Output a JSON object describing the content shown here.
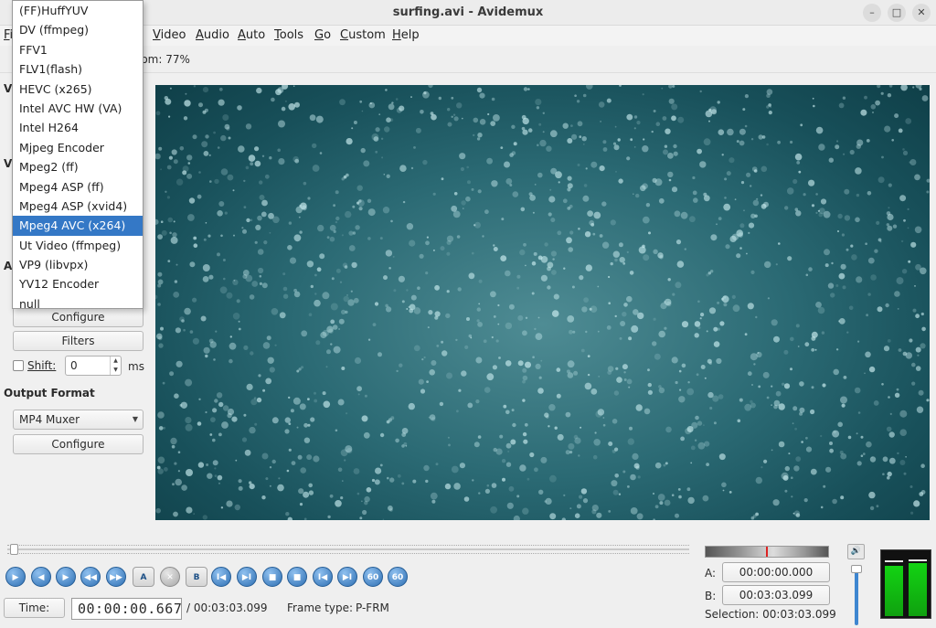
{
  "window": {
    "title": "surfing.avi - Avidemux",
    "controls": [
      "minimize-icon",
      "maximize-icon",
      "close-icon"
    ]
  },
  "menu": {
    "items": [
      {
        "label": "Fi",
        "name": "menu-file"
      },
      {
        "label": "Video",
        "name": "menu-video"
      },
      {
        "label": "Audio",
        "name": "menu-audio"
      },
      {
        "label": "Auto",
        "name": "menu-auto"
      },
      {
        "label": "Tools",
        "name": "menu-tools"
      },
      {
        "label": "Go",
        "name": "menu-go"
      },
      {
        "label": "Custom",
        "name": "menu-custom"
      },
      {
        "label": "Help",
        "name": "menu-help"
      }
    ]
  },
  "toolbar": {
    "zoom_text": "oom: 77%"
  },
  "left_panel": {
    "partial_labels": [
      "V",
      "V",
      "A"
    ],
    "configure_label": "Configure",
    "filters_label": "Filters",
    "shift_label": "Shift:",
    "shift_value": "0",
    "shift_unit": "ms",
    "output_format_heading": "Output Format",
    "output_format_value": "MP4 Muxer",
    "output_configure_label": "Configure"
  },
  "video_codec_dropdown": {
    "options": [
      "(FF)HuffYUV",
      "DV (ffmpeg)",
      "FFV1",
      "FLV1(flash)",
      "HEVC (x265)",
      "Intel AVC HW (VA)",
      "Intel H264",
      "Mjpeg Encoder",
      "Mpeg2 (ff)",
      "Mpeg4 ASP (ff)",
      "Mpeg4 ASP (xvid4)",
      "Mpeg4 AVC (x264)",
      "Ut Video (ffmpeg)",
      "VP9 (libvpx)",
      "YV12 Encoder",
      "null"
    ],
    "selected": "Mpeg4 AVC (x264)",
    "accent_color": "#3478c6"
  },
  "playback": {
    "controls": [
      {
        "icon": "play-icon",
        "glyph": "▶",
        "style": "blue"
      },
      {
        "icon": "rewind-icon",
        "glyph": "◀",
        "style": "blue"
      },
      {
        "icon": "forward-icon",
        "glyph": "▶",
        "style": "blue"
      },
      {
        "icon": "previous-frame-icon",
        "glyph": "◀◀",
        "style": "blue"
      },
      {
        "icon": "next-frame-icon",
        "glyph": "▶▶",
        "style": "blue"
      },
      {
        "icon": "set-marker-a-icon",
        "glyph": "A",
        "style": "sq"
      },
      {
        "icon": "clear-markers-icon",
        "glyph": "✕",
        "style": "grey"
      },
      {
        "icon": "set-marker-b-icon",
        "glyph": "B",
        "style": "sq"
      },
      {
        "icon": "previous-keyframe-icon",
        "glyph": "I◀",
        "style": "blue"
      },
      {
        "icon": "next-keyframe-icon",
        "glyph": "▶I",
        "style": "blue"
      },
      {
        "icon": "go-marker-a-icon",
        "glyph": "■",
        "style": "blue"
      },
      {
        "icon": "go-marker-b-icon",
        "glyph": "■",
        "style": "blue"
      },
      {
        "icon": "go-first-frame-icon",
        "glyph": "I◀",
        "style": "blue"
      },
      {
        "icon": "go-last-frame-icon",
        "glyph": "▶I",
        "style": "blue"
      },
      {
        "icon": "back-60s-icon",
        "glyph": "60",
        "style": "blue"
      },
      {
        "icon": "forward-60s-icon",
        "glyph": "60",
        "style": "blue"
      }
    ],
    "time_button_label": "Time:",
    "current_time": "00:00:00.667",
    "total_time": "/ 00:03:03.099",
    "frame_type_label": "Frame type:",
    "frame_type_value": "P-FRM",
    "position_fraction": 0.004
  },
  "selection": {
    "a_label": "A:",
    "a_value": "00:00:00.000",
    "b_label": "B:",
    "b_value": "00:03:03.099",
    "selection_text": "Selection: 00:03:03.099"
  },
  "audio": {
    "volume_icon": "speaker-icon",
    "volume_level": 1.0,
    "vu_left": 0.76,
    "vu_right": 0.8
  },
  "colors": {
    "video_bg": "#2b6a74",
    "vu_green": "#13d313",
    "button_blue": "#2e6fb3"
  }
}
